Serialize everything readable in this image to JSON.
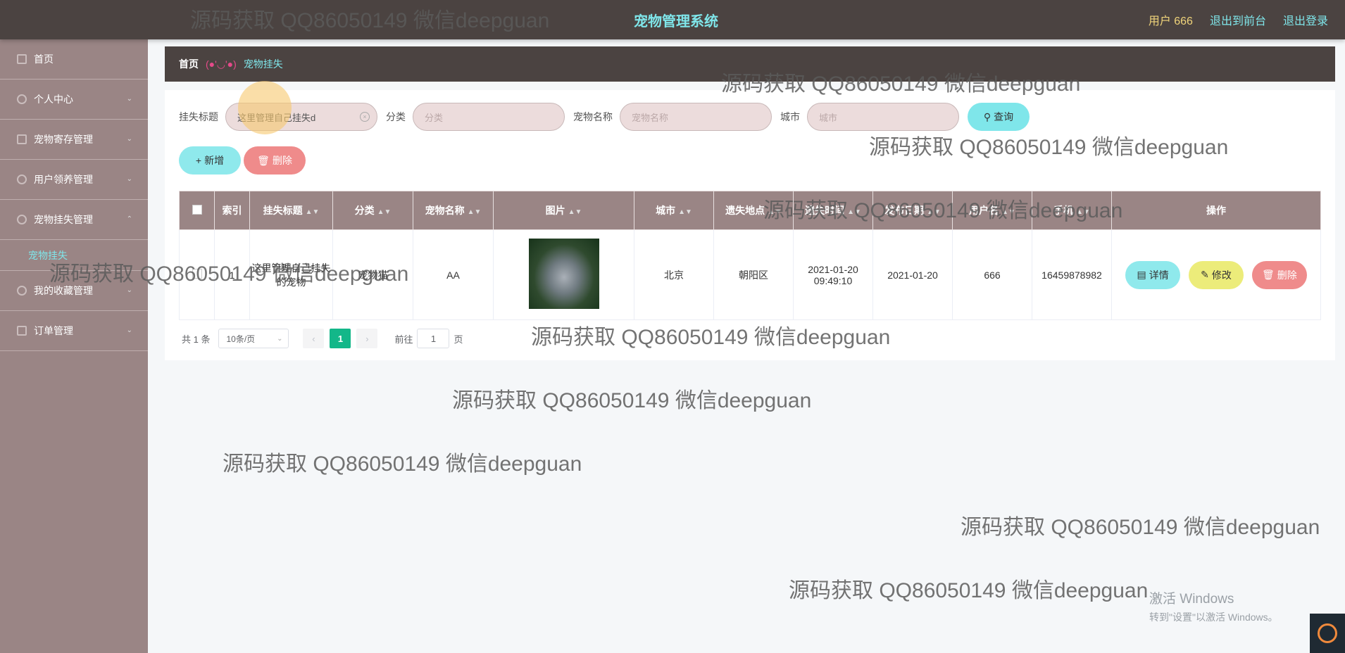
{
  "header": {
    "title": "宠物管理系统",
    "user": "用户 666",
    "back_to_front": "退出到前台",
    "logout": "退出登录"
  },
  "sidebar": {
    "items": [
      {
        "label": "首页",
        "icon": "home-icon"
      },
      {
        "label": "个人中心",
        "icon": "user-icon"
      },
      {
        "label": "宠物寄存管理",
        "icon": "box-icon"
      },
      {
        "label": "用户领养管理",
        "icon": "adopt-icon"
      },
      {
        "label": "宠物挂失管理",
        "icon": "lost-icon"
      },
      {
        "label": "宠物挂失",
        "sub": true
      },
      {
        "label": "我的收藏管理",
        "icon": "favorite-icon"
      },
      {
        "label": "订单管理",
        "icon": "order-icon"
      }
    ]
  },
  "breadcrumb": {
    "home": "首页",
    "sep": "(●'◡'●)",
    "current": "宠物挂失"
  },
  "filters": {
    "title_label": "挂失标题",
    "title_value": "这里管理自己挂失d",
    "category_label": "分类",
    "category_placeholder": "分类",
    "pet_name_label": "宠物名称",
    "pet_name_placeholder": "宠物名称",
    "city_label": "城市",
    "city_placeholder": "城市",
    "search_button": "查询"
  },
  "actions": {
    "add": "新增",
    "delete": "删除"
  },
  "table": {
    "headers": [
      "索引",
      "挂失标题",
      "分类",
      "宠物名称",
      "图片",
      "城市",
      "遗失地点",
      "遗失时间",
      "发布日期",
      "用户名",
      "手机",
      "操作"
    ],
    "rows": [
      {
        "index": "1",
        "title": "这里管理自己挂失的宠物",
        "category": "宠物猫",
        "pet_name": "AA",
        "city": "北京",
        "lost_place": "朝阳区",
        "lost_time": "2021-01-20 09:49:10",
        "publish_date": "2021-01-20",
        "username": "666",
        "phone": "16459878982",
        "detail": "详情",
        "edit": "修改",
        "delete": "删除"
      }
    ]
  },
  "pagination": {
    "total": "共 1 条",
    "page_size": "10条/页",
    "current_page": "1",
    "goto_label": "前往",
    "goto_value": "1",
    "page_suffix": "页"
  },
  "watermark": "源码获取 QQ86050149 微信deepguan",
  "windows": {
    "line1": "激活 Windows",
    "line2": "转到\"设置\"以激活 Windows。"
  }
}
